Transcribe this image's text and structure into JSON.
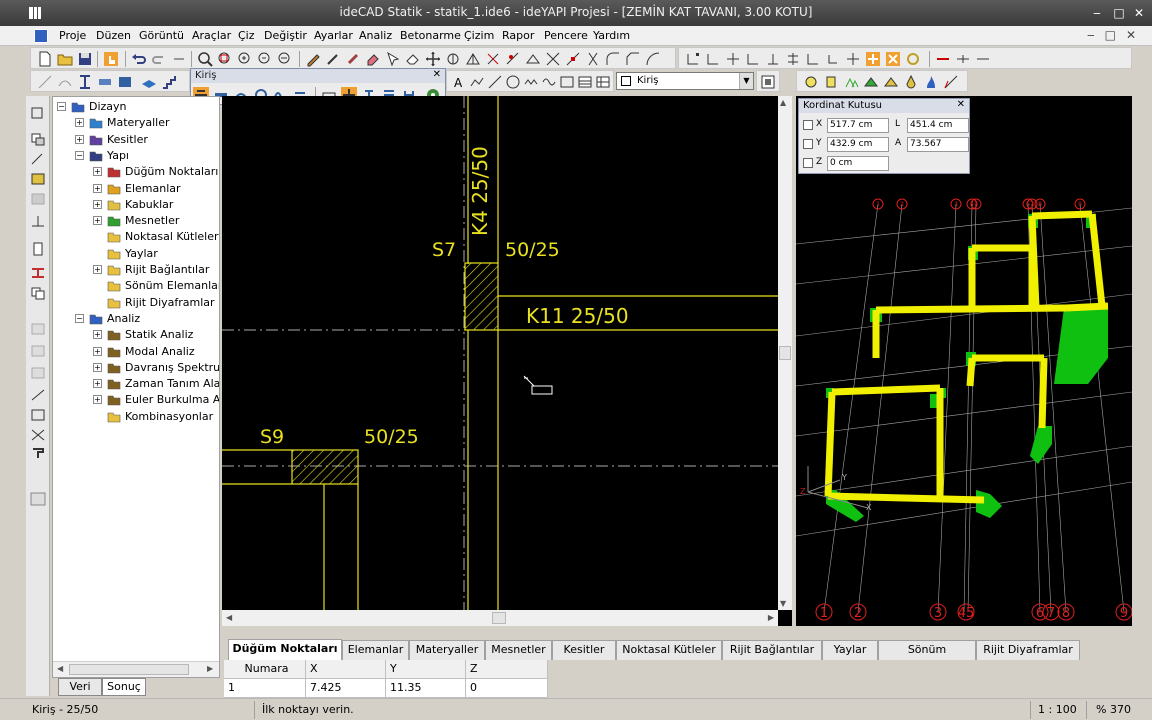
{
  "window": {
    "title": "ideCAD Statik  - statik_1.ide6 - ideYAPI Projesi - [ZEMİN KAT TAVANI,  3.00 KOTU]"
  },
  "menu": [
    "Proje",
    "Düzen",
    "Görüntü",
    "Araçlar",
    "Çiz",
    "Değiştir",
    "Ayarlar",
    "Analiz",
    "Betonarme",
    "Çizim",
    "Rapor",
    "Pencere",
    "Yardım"
  ],
  "kiris_toolbar": {
    "title": "Kiriş",
    "close": "✕"
  },
  "layer_combo": {
    "value": "Kiriş"
  },
  "tree": {
    "items": [
      {
        "label": "Dizayn",
        "level": 0,
        "expander": "−",
        "icon": "design-icon"
      },
      {
        "label": "Materyaller",
        "level": 1,
        "expander": "+",
        "icon": "materials-icon"
      },
      {
        "label": "Kesitler",
        "level": 1,
        "expander": "+",
        "icon": "sections-icon"
      },
      {
        "label": "Yapı",
        "level": 1,
        "expander": "−",
        "icon": "structure-icon"
      },
      {
        "label": "Düğüm Noktaları",
        "level": 2,
        "expander": "+",
        "icon": "nodes-icon"
      },
      {
        "label": "Elemanlar",
        "level": 2,
        "expander": "+",
        "icon": "elements-icon"
      },
      {
        "label": "Kabuklar",
        "level": 2,
        "expander": "+",
        "icon": "shells-icon"
      },
      {
        "label": "Mesnetler",
        "level": 2,
        "expander": "+",
        "icon": "supports-icon"
      },
      {
        "label": "Noktasal Kütleler",
        "level": 2,
        "expander": "",
        "icon": "folder-icon"
      },
      {
        "label": "Yaylar",
        "level": 2,
        "expander": "",
        "icon": "folder-icon"
      },
      {
        "label": "Rijit Bağlantılar",
        "level": 2,
        "expander": "+",
        "icon": "folder-icon"
      },
      {
        "label": "Sönüm Elemanları",
        "level": 2,
        "expander": "",
        "icon": "folder-icon"
      },
      {
        "label": "Rijit Diyaframlar",
        "level": 2,
        "expander": "",
        "icon": "folder-icon"
      },
      {
        "label": "Analiz",
        "level": 1,
        "expander": "−",
        "icon": "analysis-icon"
      },
      {
        "label": "Statik Analiz",
        "level": 2,
        "expander": "+",
        "icon": "static-analysis-icon"
      },
      {
        "label": "Modal Analiz",
        "level": 2,
        "expander": "+",
        "icon": "modal-analysis-icon"
      },
      {
        "label": "Davranış Spektrumu",
        "level": 2,
        "expander": "+",
        "icon": "spectrum-icon"
      },
      {
        "label": "Zaman Tanım Alanı",
        "level": 2,
        "expander": "+",
        "icon": "time-history-icon"
      },
      {
        "label": "Euler Burkulma Ana",
        "level": 2,
        "expander": "+",
        "icon": "buckling-icon"
      },
      {
        "label": "Kombinasyonlar",
        "level": 2,
        "expander": "",
        "icon": "folder-icon"
      }
    ]
  },
  "left_tabs": [
    "Veri",
    "Sonuç"
  ],
  "cad": {
    "labels": {
      "k4": "K4 25/50",
      "s7": "S7",
      "s7_dim": "50/25",
      "k11": "K11 25/50",
      "s9": "S9",
      "s9_dim": "50/25"
    }
  },
  "coord_box": {
    "title": "Kordinat Kutusu",
    "close": "✕",
    "x_label": "X",
    "x_value": "517.7 cm",
    "l_label": "L",
    "l_value": "451.4 cm",
    "y_label": "Y",
    "y_value": "432.9 cm",
    "a_label": "A",
    "a_value": "73.567",
    "z_label": "Z",
    "z_value": "0 cm"
  },
  "view3d": {
    "top_axes": [
      "1",
      "2",
      "3",
      "4",
      "5",
      "6",
      "7",
      "8",
      "9"
    ],
    "bottom_axes": [
      "1",
      "2",
      "3",
      "45",
      "6",
      "7",
      "8",
      "9"
    ],
    "axis_labels": {
      "x": "X",
      "y": "Y",
      "z": "Z"
    }
  },
  "bottom_tabs": [
    "Düğüm Noktaları",
    "Elemanlar",
    "Materyaller",
    "Mesnetler",
    "Kesitler",
    "Noktasal Kütleler",
    "Rijit Bağlantılar",
    "Yaylar",
    "Sönüm Elemanları",
    "Rijit Diyaframlar"
  ],
  "grid": {
    "headers": [
      "Numara",
      "X",
      "Y",
      "Z"
    ],
    "rows": [
      [
        "1",
        "7.425",
        "11.35",
        "0"
      ]
    ]
  },
  "status": {
    "left": "Kiriş - 25/50",
    "prompt": "İlk noktayı verin.",
    "scale": "1 : 100",
    "zoom": "% 370"
  },
  "colors": {
    "cad_yellow": "#e8e020",
    "cad_dim": "#d8d8d8",
    "beam_yellow": "#f0f000",
    "column_green": "#10c010",
    "axis_red": "#e02020"
  }
}
